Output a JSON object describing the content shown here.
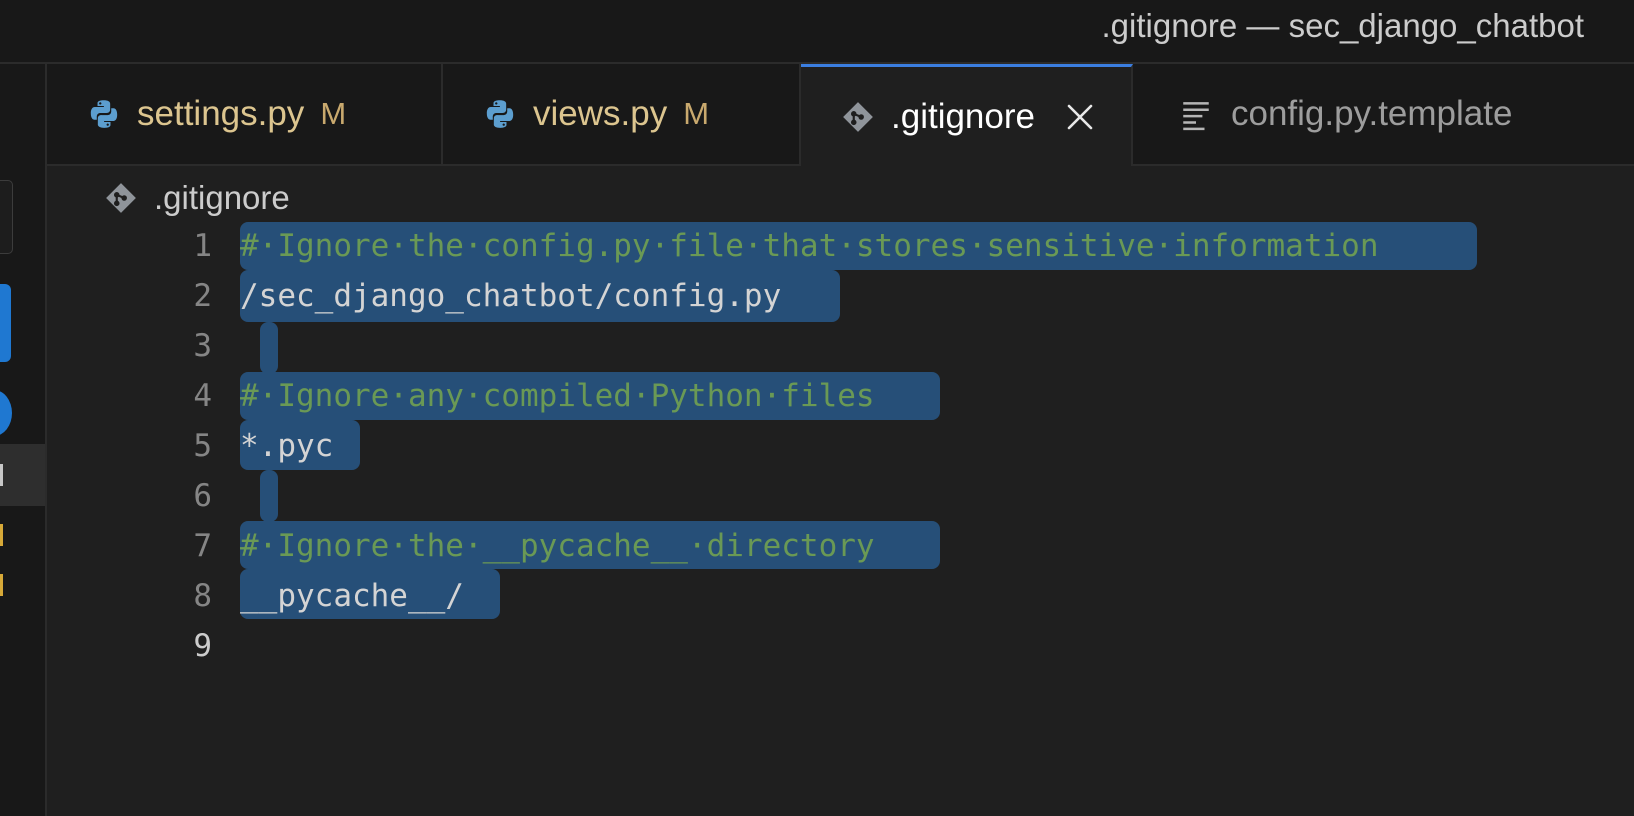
{
  "window": {
    "title": ".gitignore — sec_django_chatbot"
  },
  "tabs": [
    {
      "label": "settings.py",
      "modified": "M",
      "icon": "python-icon",
      "active": false,
      "color": "#dcc58f"
    },
    {
      "label": "views.py",
      "modified": "M",
      "icon": "python-icon",
      "active": false,
      "color": "#dcc58f"
    },
    {
      "label": ".gitignore",
      "icon": "git-icon",
      "active": true,
      "close": "close-icon"
    },
    {
      "label": "config.py.template",
      "icon": "lines-icon",
      "active": false,
      "color": "#9d9d9d"
    }
  ],
  "breadcrumb": {
    "label": ".gitignore",
    "icon": "git-icon"
  },
  "editor": {
    "current_line": 9,
    "lines": [
      {
        "number": "1",
        "text": "#·Ignore·the·config.py·file·that·stores·sensitive·information",
        "kind": "comment"
      },
      {
        "number": "2",
        "text": "/sec_django_chatbot/config.py",
        "kind": "plain"
      },
      {
        "number": "3",
        "text": "",
        "kind": "plain"
      },
      {
        "number": "4",
        "text": "#·Ignore·any·compiled·Python·files",
        "kind": "comment"
      },
      {
        "number": "5",
        "text": "*.pyc",
        "kind": "plain"
      },
      {
        "number": "6",
        "text": "",
        "kind": "plain"
      },
      {
        "number": "7",
        "text": "#·Ignore·the·__pycache__·directory",
        "kind": "comment"
      },
      {
        "number": "8",
        "text": "__pycache__/",
        "kind": "plain"
      },
      {
        "number": "9",
        "text": "",
        "kind": "plain"
      }
    ]
  },
  "colors": {
    "selection": "#264f78",
    "comment": "#6a9955",
    "accent": "#3b7ee0",
    "modified": "#dcc58f"
  }
}
